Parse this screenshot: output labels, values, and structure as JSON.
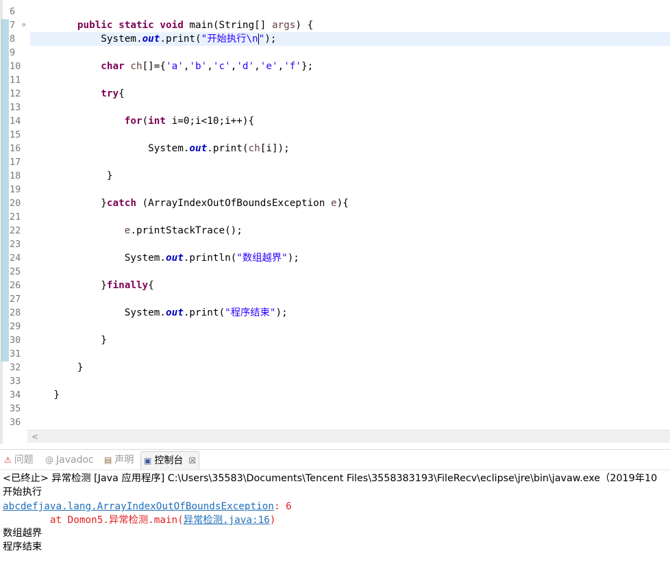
{
  "editor": {
    "line_numbers": [
      "6",
      "7",
      "8",
      "9",
      "10",
      "11",
      "12",
      "13",
      "14",
      "15",
      "16",
      "17",
      "18",
      "19",
      "20",
      "21",
      "22",
      "23",
      "24",
      "25",
      "26",
      "27",
      "28",
      "29",
      "30",
      "31",
      "32",
      "33",
      "34",
      "35",
      "36"
    ],
    "fold_marker": "⊖",
    "line7": {
      "indent": "        ",
      "kw1": "public static void",
      "rest1": " main(String[] ",
      "param": "args",
      "rest2": ") {"
    },
    "line8": {
      "indent": "            ",
      "c1": "System.",
      "fld": "out",
      "c2": ".print(",
      "str_a": "\"开始执行\\n",
      "str_b": "\"",
      "c3": ");"
    },
    "line10": {
      "indent": "            ",
      "kw": "char",
      "sp": " ",
      "var": "ch",
      "rest": "[]={",
      "s1": "'a'",
      "s2": "'b'",
      "s3": "'c'",
      "s4": "'d'",
      "s5": "'e'",
      "s6": "'f'",
      "comma": ",",
      "end": "};"
    },
    "line12": {
      "indent": "            ",
      "kw": "try",
      "rest": "{"
    },
    "line14": {
      "indent": "                ",
      "kw1": "for",
      "p1": "(",
      "kw2": "int",
      "rest": " i=0;i<10;i++){"
    },
    "line16": {
      "indent": "                    ",
      "c1": "System.",
      "fld": "out",
      "c2": ".print(",
      "var": "ch",
      "c3": "[i]);"
    },
    "line18": {
      "text": "             }"
    },
    "line20": {
      "indent": "            ",
      "c1": "}",
      "kw": "catch",
      "c2": " (ArrayIndexOutOfBoundsException ",
      "var": "e",
      "c3": "){"
    },
    "line22": {
      "indent": "                ",
      "var": "e",
      "rest": ".printStackTrace();"
    },
    "line24": {
      "indent": "                ",
      "c1": "System.",
      "fld": "out",
      "c2": ".println(",
      "str": "\"数组越界\"",
      "c3": ");"
    },
    "line26": {
      "indent": "            ",
      "c1": "}",
      "kw": "finally",
      "c2": "{"
    },
    "line28": {
      "indent": "                ",
      "c1": "System.",
      "fld": "out",
      "c2": ".print(",
      "str": "\"程序结束\"",
      "c3": ");"
    },
    "line30": {
      "text": "            }"
    },
    "line32": {
      "text": "        }"
    },
    "line34": {
      "text": "    }"
    },
    "scroll_left": "<"
  },
  "tabs": [
    {
      "icon": "⚠",
      "label": "问题"
    },
    {
      "icon": "@",
      "label": "Javadoc"
    },
    {
      "icon": "▤",
      "label": "声明"
    },
    {
      "icon": "▣",
      "label": "控制台",
      "close": "☒"
    }
  ],
  "console": {
    "terminated": "<已终止> 异常检测 [Java 应用程序] C:\\Users\\35583\\Documents\\Tencent Files\\3558383193\\FileRecv\\eclipse\\jre\\bin\\javaw.exe（2019年10",
    "out1": "开始执行",
    "out2_link": "abcdefjava.lang.ArrayIndexOutOfBoundsException",
    "out2_rest": ": 6",
    "out3_prefix": "        at Domon5.异常检测.main(",
    "out3_link": "异常检测.java:16",
    "out3_suffix": ")",
    "out4": "数组越界",
    "out5": "程序结束"
  }
}
